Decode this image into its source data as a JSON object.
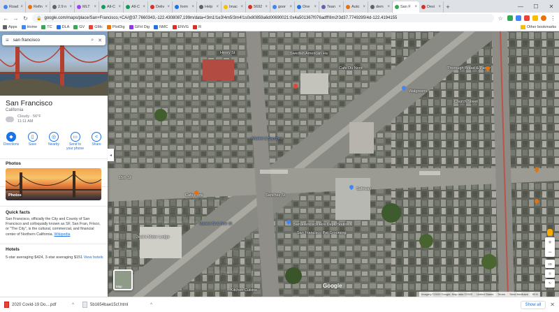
{
  "browser": {
    "tabs": [
      {
        "label": "Road",
        "color": "#4285f4"
      },
      {
        "label": "Refin",
        "color": "#e8710a"
      },
      {
        "label": "2.9 n",
        "color": "#5f6368"
      },
      {
        "label": "MLT",
        "color": "#a142f4"
      },
      {
        "label": "All-C",
        "color": "#0f9d58"
      },
      {
        "label": "All-C",
        "color": "#0f9d58"
      },
      {
        "label": "Deliv",
        "color": "#d93025"
      },
      {
        "label": "form",
        "color": "#1a73e8"
      },
      {
        "label": "Help",
        "color": "#5f6368"
      },
      {
        "label": "Imac",
        "color": "#fbbc04"
      },
      {
        "label": "5692",
        "color": "#d93025"
      },
      {
        "label": "goor",
        "color": "#4285f4"
      },
      {
        "label": "One",
        "color": "#1a73e8"
      },
      {
        "label": "Tean",
        "color": "#6264a7"
      },
      {
        "label": "Auto",
        "color": "#e8710a"
      },
      {
        "label": "dem",
        "color": "#5f6368"
      },
      {
        "label": "San F",
        "color": "#34a853",
        "active": true
      },
      {
        "label": "Desi",
        "color": "#d93025"
      }
    ],
    "new_tab": "+",
    "url": "google.com/maps/place/San+Francisco,+CA/@37.7660343,-122.4308087,199m/data=!3m1!1e3!4m5!3m4!1s0x80859a6d00690021:0x4a501367f076adff!8m2!3d37.7749295!4d-122.4194155",
    "bookmarks": [
      {
        "label": "Apps",
        "color": "#5f6368"
      },
      {
        "label": "Home",
        "color": "#4285f4"
      },
      {
        "label": "TC",
        "color": "#34a853"
      },
      {
        "label": "DLA",
        "color": "#1a73e8"
      },
      {
        "label": "GV",
        "color": "#34a853"
      },
      {
        "label": "GMc",
        "color": "#ea4335"
      },
      {
        "label": "PlotDig",
        "color": "#e8710a"
      },
      {
        "label": "GFH Dig",
        "color": "#9334e6"
      },
      {
        "label": "NMC",
        "color": "#1a73e8"
      },
      {
        "label": "ENVG",
        "color": "#d93025"
      },
      {
        "label": "R",
        "color": "#d93025"
      }
    ],
    "other_bookmarks": "Other bookmarks"
  },
  "search": {
    "value": "san francisco"
  },
  "place": {
    "title": "San Francisco",
    "subtitle": "California",
    "weather_line1": "Cloudy · 56°F",
    "weather_line2": "11:11 AM"
  },
  "actions": [
    {
      "label": "Directions",
      "icon": "◆",
      "primary": true
    },
    {
      "label": "Save",
      "icon": "▯"
    },
    {
      "label": "Nearby",
      "icon": "◎"
    },
    {
      "label": "Send to your phone",
      "icon": "▭"
    },
    {
      "label": "Share",
      "icon": "<"
    }
  ],
  "photos": {
    "heading": "Photos",
    "tile_label": "Photos"
  },
  "facts": {
    "heading": "Quick facts",
    "text": "San Francisco, officially the City and County of San Francisco and colloquially known as SF, San Fran, Frisco, or \"The City\", is the cultural, commercial, and financial center of Northern California.",
    "link": "Wikipedia"
  },
  "hotels": {
    "heading": "Hotels",
    "text": "5-star averaging $424, 3-star averaging $151",
    "link": "View hotels"
  },
  "map": {
    "labels": [
      {
        "t": "Henry St"
      },
      {
        "t": "Swedish American Ha"
      },
      {
        "t": "Cafe Du Nord"
      },
      {
        "t": "Thorough Bread & Pastry"
      },
      {
        "t": "Walgreens"
      },
      {
        "t": "Church Street"
      },
      {
        "t": "Market & Sanchez"
      },
      {
        "t": "15th St"
      },
      {
        "t": "Sanchez St"
      },
      {
        "t": "Safeway"
      },
      {
        "t": "Market St & Noe St"
      },
      {
        "t": "San Francisco Fire Dept. Station 6"
      },
      {
        "t": "Jack's Motor Lodge"
      },
      {
        "t": "Cafe Flore"
      },
      {
        "t": "San Francisco Pet Grooming"
      },
      {
        "t": "Kitchen Cuisine"
      }
    ],
    "satellite_label": "Map",
    "google_mark": "Google",
    "attribution": [
      "Imagery ©2020 Google, Map data ©2020",
      "United States",
      "Terms",
      "Send feedback",
      "50 ft"
    ],
    "zoom_plus": "+",
    "zoom_minus": "−",
    "ctrl_3d": "3D"
  },
  "downloads": {
    "items": [
      {
        "label": "2020 Covid-19 Do....pdf",
        "type": "pdf"
      },
      {
        "label": "5b1654bae15cf.html",
        "type": "html"
      }
    ],
    "show_all": "Show all"
  }
}
